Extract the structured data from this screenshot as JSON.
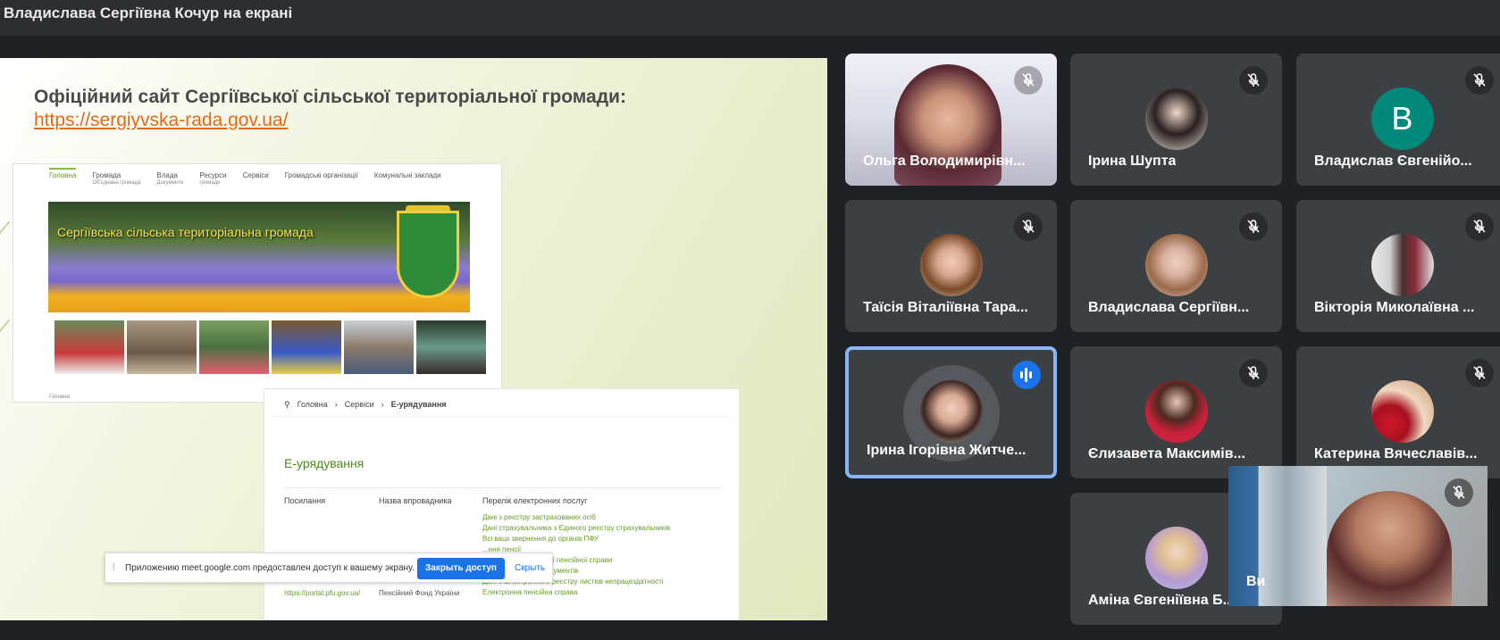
{
  "window": {
    "presenter_title": "Владислава Сергіївна Кочур на екрані"
  },
  "presentation": {
    "slide_title": "Офіційний сайт Сергіївської сільської територіальної громади:",
    "slide_link": "https://sergiyvska-rada.gov.ua/",
    "site1": {
      "nav": [
        {
          "label": "Головна",
          "sub": ""
        },
        {
          "label": "Громада",
          "sub": "Об'єднана громада"
        },
        {
          "label": "Влада",
          "sub": "Документи"
        },
        {
          "label": "Ресурси",
          "sub": "громади"
        },
        {
          "label": "Сервіси",
          "sub": ""
        },
        {
          "label": "Громадські організації",
          "sub": ""
        },
        {
          "label": "Комунальні заклади",
          "sub": ""
        }
      ],
      "banner_text": "Сергіївська сільська територіальна громада",
      "footer": "Головна"
    },
    "site2": {
      "breadcrumb": [
        "Головна",
        "Сервіси",
        "Е-урядування"
      ],
      "heading": "Е-урядування",
      "columns": [
        "Посилання",
        "Назва впровадника",
        "Перелік електронних послуг"
      ],
      "services": [
        "Дані з реєстру застрахованих осіб",
        "Дані страхувальника з Єдиного реєстру страхувальників",
        "Всі ваші звернення до органів ПФУ",
        "...ння пенсії",
        "...змін до електронної пенсійної справи",
        "...на електронних документів",
        "Дані з Електронного реєстру листків непрацездатності",
        "Електронна пенсійна справа"
      ],
      "row_url": "https://portal.pfu.gov.ua/",
      "row_name": "Пенсійний Фонд України"
    }
  },
  "share_bar": {
    "message": "Приложению meet.google.com предоставлен доступ к вашему экрану.",
    "stop_label": "Закрыть доступ",
    "hide_label": "Скрыть"
  },
  "participants": [
    {
      "name": "Ольга Володимирівн...",
      "type": "video"
    },
    {
      "name": "Ірина Шупта",
      "type": "photo"
    },
    {
      "name": "Владислав Євгенійо...",
      "type": "letter",
      "letter": "В"
    },
    {
      "name": "Таїсія Віталіївна Тара...",
      "type": "photo"
    },
    {
      "name": "Владислава Сергіївн...",
      "type": "photo"
    },
    {
      "name": "Вікторія Миколаївна ...",
      "type": "photo"
    },
    {
      "name": "Ірина Ігорівна Житче...",
      "type": "photo",
      "speaking": true
    },
    {
      "name": "Єлизавета Максимів...",
      "type": "photo"
    },
    {
      "name": "Катерина Вячеславів...",
      "type": "photo"
    },
    {
      "name": "Аміна Євгеніївна Б...",
      "type": "photo"
    }
  ],
  "self_view": {
    "label": "Ви"
  },
  "colors": {
    "accent": "#1a73e8",
    "tile_bg": "#3c4043",
    "page_bg": "#202124",
    "link": "#e06b1a",
    "speaker_border": "#8ab4f8"
  }
}
